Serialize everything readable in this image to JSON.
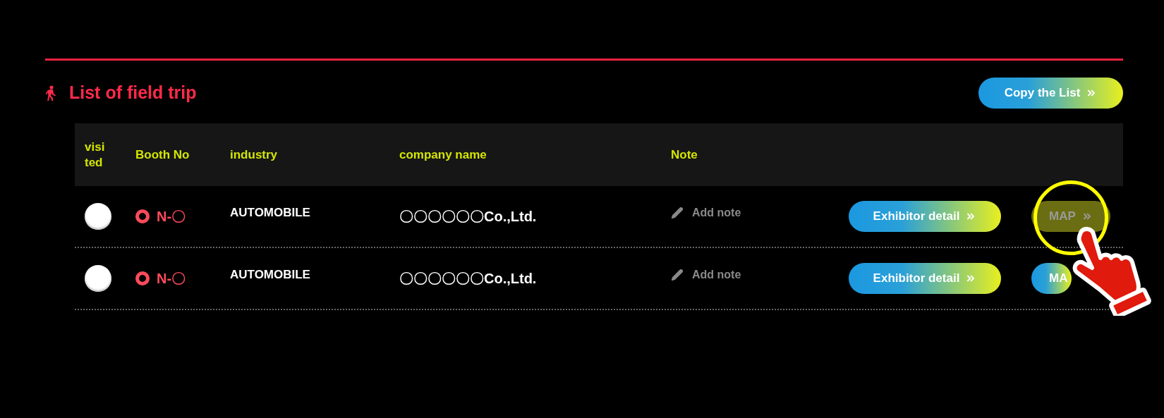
{
  "section": {
    "title": "List of field trip",
    "copy_button": "Copy the List"
  },
  "table": {
    "columns": [
      "visi\nted",
      "Booth No",
      "industry",
      "company name",
      "Note"
    ],
    "rows": [
      {
        "visited": false,
        "booth_no": "N-〇",
        "industry": "AUTOMOBILE",
        "company_name": "〇〇〇〇〇〇Co.,Ltd.",
        "note_placeholder": "Add note",
        "detail_button": "Exhibitor detail",
        "map_button": {
          "label": "MAP",
          "highlighted": true
        }
      },
      {
        "visited": false,
        "booth_no": "N-〇",
        "industry": "AUTOMOBILE",
        "company_name": "〇〇〇〇〇〇Co.,Ltd.",
        "note_placeholder": "Add note",
        "detail_button": "Exhibitor detail",
        "map_button": {
          "label": "MA",
          "highlighted": false
        }
      }
    ]
  }
}
